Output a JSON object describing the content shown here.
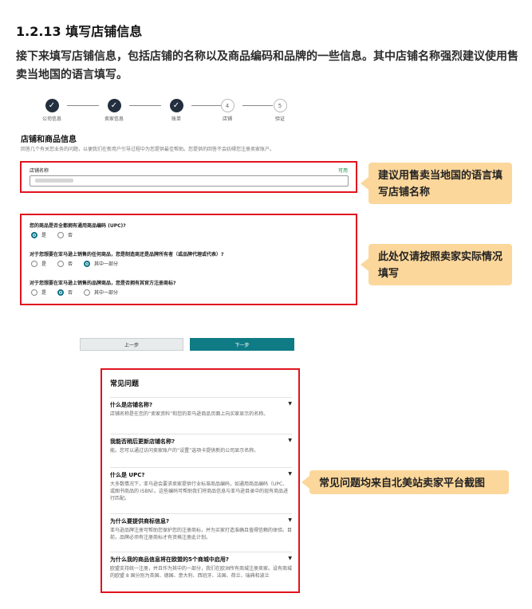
{
  "section": {
    "title": "1.2.13 填写店铺信息",
    "intro": "接下来填写店铺信息，包括店铺的名称以及商品编码和品牌的一些信息。其中店铺名称强烈建议使用售卖当地国的语言填写。"
  },
  "stepper": {
    "steps": [
      {
        "label": "公司信息",
        "num": "✓"
      },
      {
        "label": "卖家信息",
        "num": "✓"
      },
      {
        "label": "账单",
        "num": "✓"
      },
      {
        "label": "店铺",
        "num": "4"
      },
      {
        "label": "验证",
        "num": "5"
      }
    ]
  },
  "store": {
    "title": "店铺和商品信息",
    "desc": "回答几个有关您业务的问题，以便我们在新用户引导过程中为您提供最佳帮助。您提供的回答不会妨碍您注册卖家账户。",
    "name_label": "店铺名称",
    "name_available": "可用"
  },
  "questions": [
    {
      "text": "您的商品是否全都拥有通用商品编码 (UPC)?",
      "options": [
        "是",
        "否"
      ],
      "selected": 0
    },
    {
      "text": "对于您想要在亚马逊上销售的任何商品，您是制造商还是品牌所有者（或品牌代理或代表）?",
      "options": [
        "是",
        "否",
        "其中一部分"
      ],
      "selected": 2
    },
    {
      "text": "对于您想要在亚马逊上销售的品牌商品，您是否拥有其官方注册商标?",
      "options": [
        "是",
        "否",
        "其中一部分"
      ],
      "selected": 1
    }
  ],
  "buttons": {
    "prev": "上一步",
    "next": "下一步"
  },
  "faq": {
    "title": "常见问题",
    "items": [
      {
        "q": "什么是店铺名称?",
        "a": "店铺名称是在您的“卖家资料”和您的亚马逊商品页面上向买家显示的名称。"
      },
      {
        "q": "我能否稍后更新店铺名称?",
        "a": "能。您可以通过访问卖家账户的“设置”选项卡提供新的公司显示名称。"
      },
      {
        "q": "什么是 UPC?",
        "a": "大多数情况下，亚马逊会要求卖家提供行业标准商品编码，如通用商品编码（UPC、或图书商品的 ISBN）。这些编码可帮助我们将商品信息与亚马逊目录中的现有商品进行匹配。"
      },
      {
        "q": "为什么要提供商标信息?",
        "a": "亚马逊品牌注册可帮助您保护您的注册商标，并为买家打造准确且值得信赖的体验。目前，品牌必须有注册商标才有资格注册此计划。"
      },
      {
        "q": "为什么我的商品信息将在欧盟的5个商城中启用?",
        "a": "欧盟支持统一注册，并且作为其中的一部分，我们在欧洲所有商城注册卖家。设有商城的欧盟 8 国分别为英国、德国、意大利、西班牙、法国、荷兰、瑞典和波兰"
      }
    ]
  },
  "callouts": {
    "store_name": "建议用售卖当地国的语言填写店铺名称",
    "brand": "此处仅请按照卖家实际情况填写",
    "faq": "常见问题均来自北美站卖家平台截图"
  },
  "colors": {
    "highlight": "#e0141e",
    "callout": "#fcd79b",
    "primary_button": "#0f7b84"
  }
}
